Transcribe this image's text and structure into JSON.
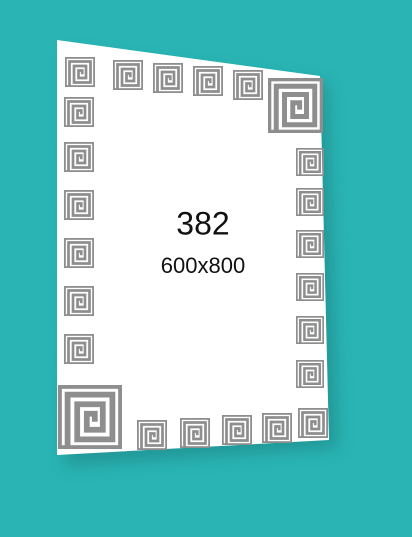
{
  "product": {
    "model_number": "382",
    "size": "600x800"
  },
  "colors": {
    "background": "#2ab4b4",
    "mirror": "#ffffff",
    "pattern": "#8e8e8e",
    "pattern_stroke": "#777777",
    "shadow": "#1e8080"
  },
  "decoration": {
    "motif": "greek-key-spiral-icon"
  }
}
